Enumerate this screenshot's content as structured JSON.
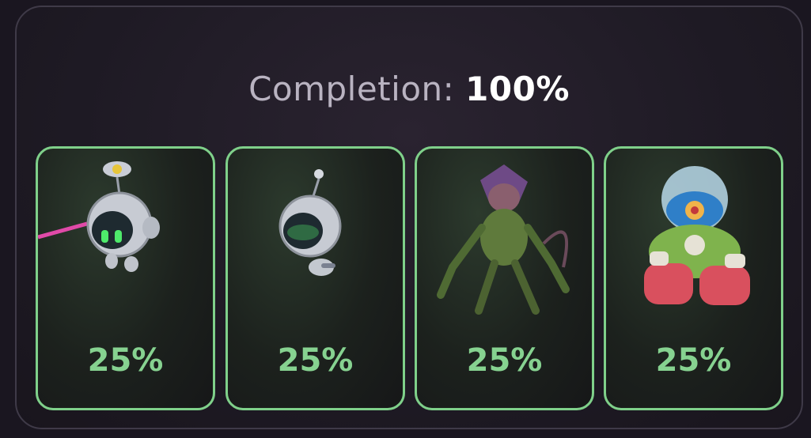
{
  "completion": {
    "label": "Completion:",
    "value": "100%"
  },
  "cards": [
    {
      "name": "robot-with-laser",
      "percent": "25%"
    },
    {
      "name": "robot-small",
      "percent": "25%"
    },
    {
      "name": "mutant-creature",
      "percent": "25%"
    },
    {
      "name": "armored-bot",
      "percent": "25%"
    }
  ],
  "colors": {
    "card_border": "#7fd08a",
    "percent_text": "#86d290",
    "title_label": "#b9b3c1",
    "title_value": "#ffffff"
  }
}
